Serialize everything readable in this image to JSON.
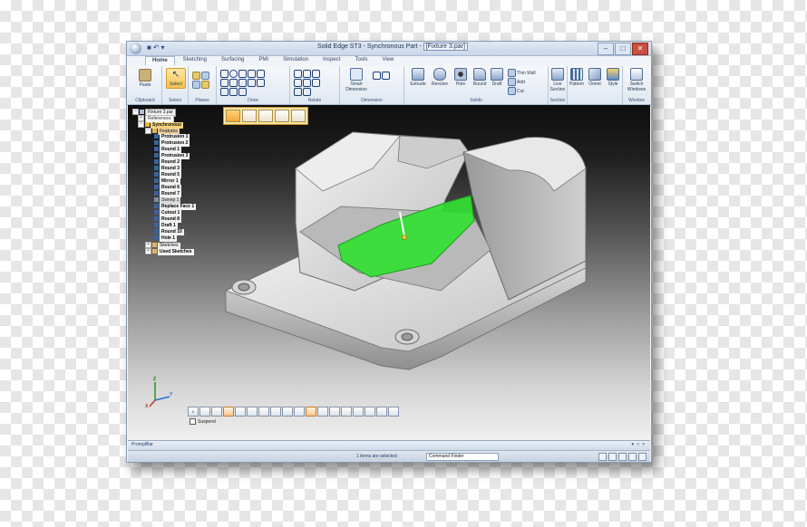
{
  "window": {
    "title": "Solid Edge ST3 - Synchronous Part - [Fixture 3.par]",
    "title_prefix": "Solid Edge ST3 - Synchronous Part - ",
    "file_name": "[Fixture 3.par]"
  },
  "ribbon": {
    "tabs": [
      "Home",
      "Sketching",
      "Surfacing",
      "PMI",
      "Simulation",
      "Inspect",
      "Tools",
      "View"
    ],
    "active_tab": "Home",
    "groups": {
      "clipboard": {
        "label": "Clipboard",
        "paste": "Paste"
      },
      "select": {
        "label": "Select",
        "select_btn": "Select"
      },
      "planes": {
        "label": "Planes"
      },
      "draw": {
        "label": "Draw"
      },
      "relate": {
        "label": "Relate"
      },
      "dimension": {
        "label": "Dimension",
        "smart_dimension": "Smart Dimension"
      },
      "solids": {
        "label": "Solids",
        "extrude": "Extrude",
        "revolve": "Revolve",
        "hole": "Hole",
        "round": "Round",
        "draft": "Draft",
        "thin_wall": "Thin Wall",
        "add": "Add",
        "cut": "Cut"
      },
      "section": {
        "label": "Section",
        "live_section": "Live Section"
      },
      "pattern": {
        "pattern": "Pattern",
        "orient": "Orient",
        "style": "Style"
      },
      "window": {
        "label": "Window",
        "switch_windows": "Switch Windows"
      }
    }
  },
  "pathfinder": {
    "file": "Fixture 3.par",
    "references": "References",
    "synchronous": "Synchronous",
    "features_label": "Features",
    "features": [
      "Protrusion 1",
      "Protrusion 2",
      "Round 1",
      "Protrusion 3",
      "Round 2",
      "Round 3",
      "Round 5",
      "Mirror 1",
      "Round 6",
      "Round 7"
    ],
    "sweep": "Sweep 1",
    "features_after": [
      "Replace Face 1",
      "Cutout 1",
      "Round 8",
      "Draft 1",
      "Round 10",
      "Hole 1"
    ],
    "sketches": "Sketches",
    "used_sketches": "Used Sketches"
  },
  "triad": {
    "x": "X",
    "y": "Y",
    "z": "Z"
  },
  "selection_bar": {
    "suspend_label": "Suspend"
  },
  "prompt_bar": {
    "label": "PromptBar"
  },
  "status_bar": {
    "message": "1 items are selected",
    "command_finder": "Command Finder"
  },
  "colors": {
    "highlight_green": "#33e033",
    "accent_orange": "#f3b440",
    "part_gray": "#c9c9c9"
  },
  "icons": {
    "paste": "clipboard-icon",
    "select": "arrow-cursor-icon",
    "extrude": "extrude-icon",
    "revolve": "revolve-icon",
    "hole": "hole-icon",
    "round": "round-icon",
    "draft": "draft-icon",
    "live_section": "live-section-icon",
    "pattern": "pattern-icon",
    "orient": "orient-icon",
    "style": "style-icon",
    "switch_windows": "switch-windows-icon"
  }
}
